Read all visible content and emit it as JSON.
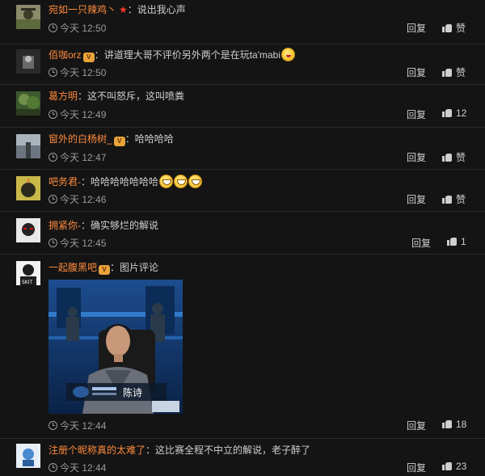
{
  "labels": {
    "reply": "回复",
    "like": "赞"
  },
  "comments": [
    {
      "user": "宛如一只辣鸡丶",
      "text": "说出我心声",
      "time": "今天 12:50",
      "likes": ""
    },
    {
      "user": "佰咖orz",
      "text": "讲道理大哥不评价另外两个是在玩ta'mabi",
      "time": "今天 12:50",
      "likes": ""
    },
    {
      "user": "葛方明",
      "text": "这不叫怒斥，这叫喷粪",
      "time": "今天 12:49",
      "likes": "12"
    },
    {
      "user": "窗外的白杨树_",
      "text": "哈哈哈哈",
      "time": "今天 12:47",
      "likes": ""
    },
    {
      "user": "吧务君-",
      "text": "哈哈哈哈哈哈哈",
      "time": "今天 12:46",
      "likes": ""
    },
    {
      "user": "拥紧你-",
      "text": "确实够烂的解说",
      "time": "今天 12:45",
      "likes": "1"
    },
    {
      "user": "一起腹黑吧",
      "text": "图片评论",
      "time": "今天 12:44",
      "likes": "18",
      "image_caption": "陈诗"
    },
    {
      "user": "注册个昵称真的太难了",
      "text": "这比赛全程不中立的解说，老子醉了",
      "time": "今天 12:44",
      "likes": "23"
    }
  ]
}
